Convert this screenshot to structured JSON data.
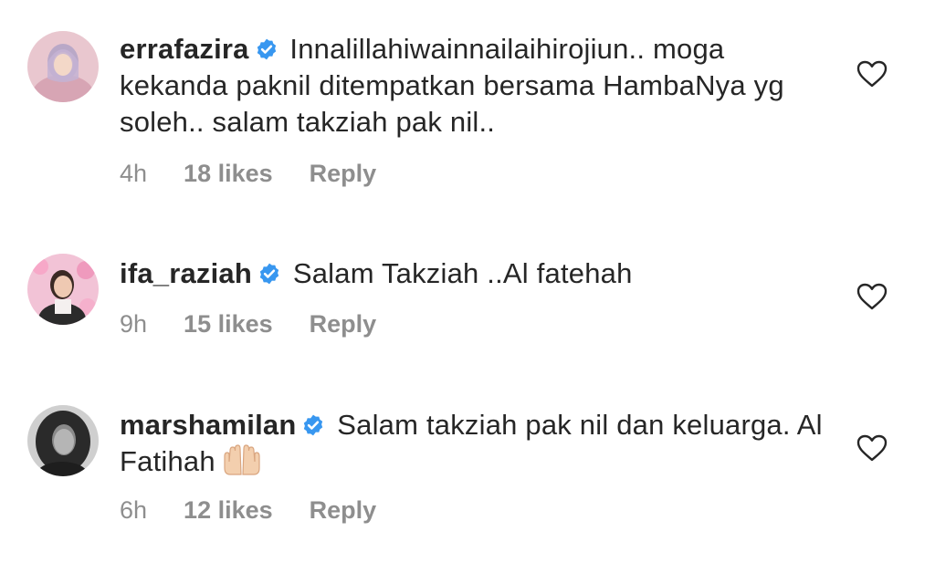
{
  "comments": [
    {
      "username": "errafazira",
      "text": "Innalillahiwainnailaihirojiun.. moga kekanda paknil ditempatkan bersama HambaNya yg soleh.. salam takziah pak nil..",
      "time": "4h",
      "likes": "18 likes",
      "reply": "Reply",
      "verified": true
    },
    {
      "username": "ifa_raziah",
      "text": "Salam Takziah ..Al fatehah",
      "time": "9h",
      "likes": "15 likes",
      "reply": "Reply",
      "verified": true
    },
    {
      "username": "marshamilan",
      "text": "Salam takziah pak nil dan keluarga. Al Fatihah",
      "emoji": "raising-hands",
      "time": "6h",
      "likes": "12 likes",
      "reply": "Reply",
      "verified": true
    }
  ],
  "icons": {
    "verified": "verified-badge-icon",
    "like": "heart-outline-icon"
  },
  "colors": {
    "text": "#262626",
    "meta": "#8e8e8e",
    "verified": "#3897f0"
  }
}
